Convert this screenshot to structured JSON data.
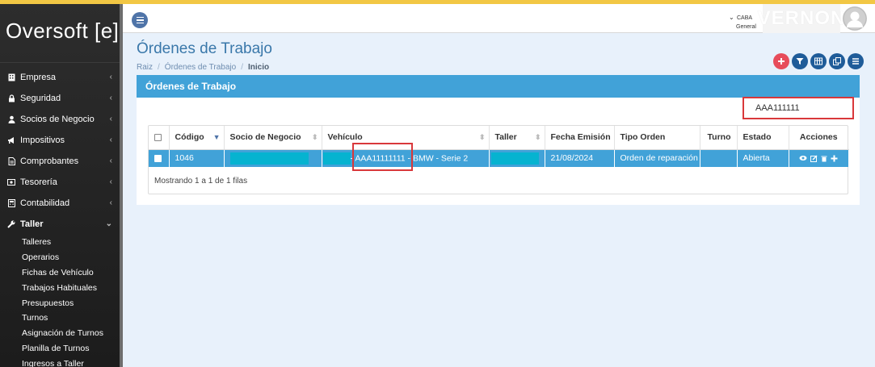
{
  "sidebar": {
    "logo": "Oversoft [e]",
    "items": [
      {
        "label": "Empresa",
        "icon": "building-icon",
        "chevron": "‹"
      },
      {
        "label": "Seguridad",
        "icon": "lock-icon",
        "chevron": "‹"
      },
      {
        "label": "Socios de Negocio",
        "icon": "user-icon",
        "chevron": "‹"
      },
      {
        "label": "Impositivos",
        "icon": "bullhorn-icon",
        "chevron": "‹"
      },
      {
        "label": "Comprobantes",
        "icon": "document-icon",
        "chevron": "‹"
      },
      {
        "label": "Tesorería",
        "icon": "money-icon",
        "chevron": "‹"
      },
      {
        "label": "Contabilidad",
        "icon": "calculator-icon",
        "chevron": "‹"
      },
      {
        "label": "Taller",
        "icon": "wrench-icon",
        "chevron": "⌄"
      }
    ],
    "subitems": [
      "Talleres",
      "Operarios",
      "Fichas de Vehículo",
      "Trabajos Habituales",
      "Presupuestos",
      "Turnos",
      "Asignación de Turnos",
      "Planilla de Turnos",
      "Ingresos a Taller"
    ]
  },
  "header": {
    "location_city": "CABA",
    "location_sub": "General",
    "brand_watermark": "VERNON"
  },
  "page": {
    "title": "Órdenes de Trabajo",
    "breadcrumb": [
      "Raiz",
      "Órdenes de Trabajo",
      "Inicio"
    ]
  },
  "panel": {
    "title": "Órdenes de Trabajo",
    "search_value": "AAA111111"
  },
  "table": {
    "columns": [
      "Código",
      "Socio de Negocio",
      "Vehículo",
      "Taller",
      "Fecha Emisión",
      "Tipo Orden",
      "Turno",
      "Estado",
      "Acciones"
    ],
    "rows": [
      {
        "codigo": "1046",
        "vehiculo_dash": "-",
        "vehiculo": "- AAA11111111 - BMW - Serie 2",
        "fecha": "21/08/2024",
        "tipo": "Orden de reparación",
        "turno": "",
        "estado": "Abierta"
      }
    ],
    "footer": "Mostrando 1 a 1 de 1 filas"
  },
  "colors": {
    "accent": "#41a2d8",
    "highlight": "#d9383b",
    "top_stripe": "#f2c744",
    "redaction": "#06b3d0"
  }
}
